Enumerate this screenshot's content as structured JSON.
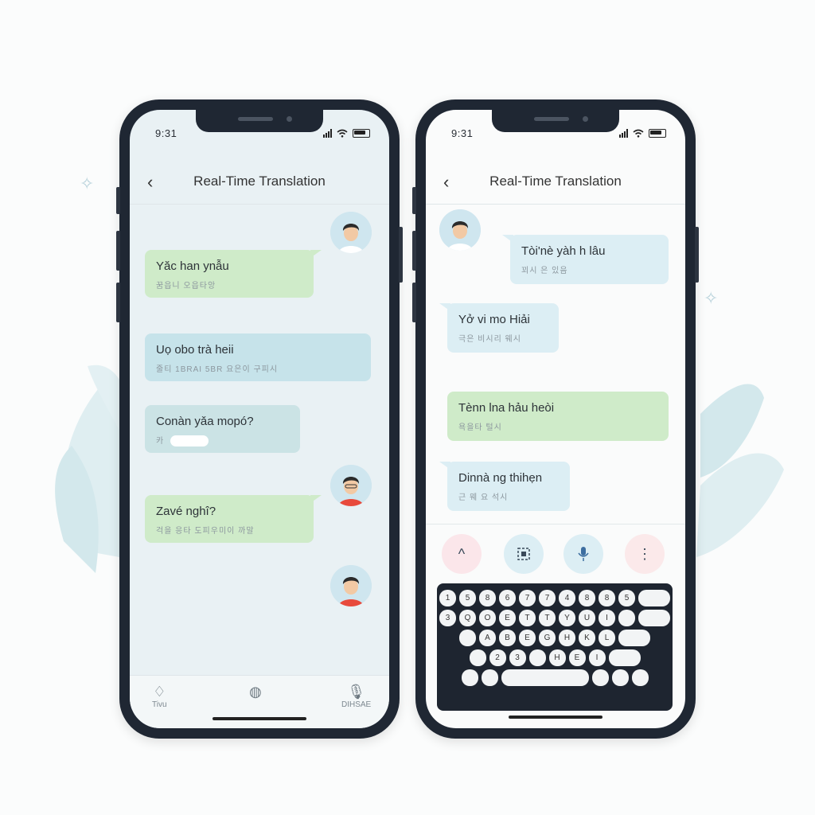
{
  "theme": {
    "green_bubble": "#cfebc9",
    "blue_bubble": "#c6e3ea",
    "phone_frame": "#1f2733",
    "light_bubble": "#dceef4"
  },
  "left_phone": {
    "status": {
      "time": "9:31"
    },
    "header": {
      "back_icon": "chevron-left-icon",
      "title": "Real-Time Translation"
    },
    "messages": [
      {
        "text": "Yăc han ynẫu",
        "translation": "꿈읍니 오읍타앙"
      },
      {
        "text": "Uọ obo trà heii",
        "translation": "줄티 1BRAI 5BR 요은이 구피시"
      },
      {
        "text": "Conàn yǎa mopó?",
        "translation": "카"
      },
      {
        "text": "Zavé nghî?",
        "translation": "걱을 응타 도피우미이 까말"
      }
    ],
    "tabbar": {
      "items": [
        {
          "icon": "bell-icon",
          "label": "Tivu"
        },
        {
          "icon": "globe-icon",
          "label": ""
        },
        {
          "icon": "microphone-icon",
          "label": "DIHSAE"
        }
      ]
    }
  },
  "right_phone": {
    "status": {
      "time": "9:31"
    },
    "header": {
      "back_icon": "chevron-left-icon",
      "title": "Real-Time Translation"
    },
    "messages": [
      {
        "text": "Tòi'nè yàh h lâu",
        "translation": "꾀시 은 있음"
      },
      {
        "text": "Yở vi mo Hiải",
        "translation": "극은 비시리 웨시"
      },
      {
        "text": "Tènn lna hảu heòi",
        "translation": "욕을타 털시"
      },
      {
        "text": "Dinnà ng thihẹn",
        "translation": "근 웨 요 석시"
      }
    ],
    "toolbar": {
      "buttons": [
        {
          "icon": "chevron-up-icon",
          "label": "^"
        },
        {
          "icon": "grid-icon",
          "label": ""
        },
        {
          "icon": "microphone-icon",
          "label": ""
        },
        {
          "icon": "more-vertical-icon",
          "label": "⋮"
        }
      ]
    },
    "keyboard": {
      "rows": [
        [
          "1",
          "5",
          "8",
          "6",
          "7",
          "7",
          "4",
          "8",
          "8",
          "5",
          ""
        ],
        [
          "3",
          "Q",
          "O",
          "E",
          "T",
          "T",
          "Y",
          "U",
          "I",
          "",
          ""
        ],
        [
          "",
          "A",
          "B",
          "E",
          "G",
          "H",
          "K",
          "L",
          ""
        ],
        [
          "",
          "2",
          "3",
          "",
          "H",
          "E",
          "I",
          ""
        ],
        [
          "",
          "",
          "",
          "",
          "",
          ""
        ]
      ]
    }
  }
}
